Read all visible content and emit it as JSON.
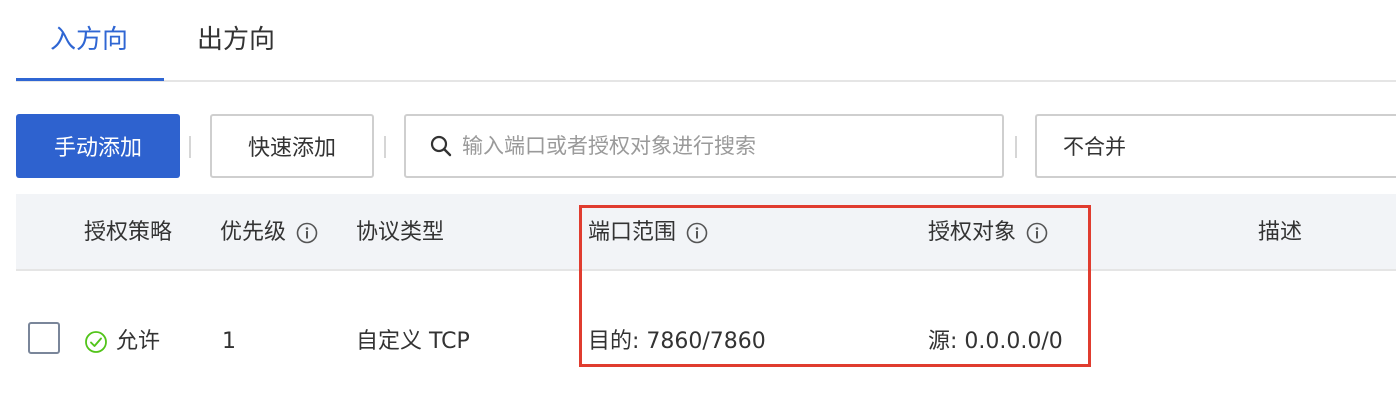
{
  "tabs": [
    {
      "label": "入方向",
      "active": true
    },
    {
      "label": "出方向",
      "active": false
    }
  ],
  "toolbar": {
    "manual_add": "手动添加",
    "quick_add": "快速添加",
    "search_placeholder": "输入端口或者授权对象进行搜索",
    "merge_select": "不合并"
  },
  "table": {
    "headers": {
      "policy": "授权策略",
      "priority": "优先级",
      "protocol": "协议类型",
      "port_range": "端口范围",
      "auth_object": "授权对象",
      "description": "描述"
    },
    "rows": [
      {
        "policy": "允许",
        "priority": "1",
        "protocol": "自定义 TCP",
        "port_range": "目的: 7860/7860",
        "auth_object": "源: 0.0.0.0/0",
        "description": ""
      }
    ]
  },
  "icons": {
    "search": "search-icon",
    "info": "info-icon",
    "allow": "check-circle-icon"
  },
  "colors": {
    "primary": "#2e62cf",
    "tab_active": "#2f66d3",
    "allow_green": "#52c41a",
    "highlight_red": "#e03c2f",
    "header_bg": "#f2f4f7"
  }
}
